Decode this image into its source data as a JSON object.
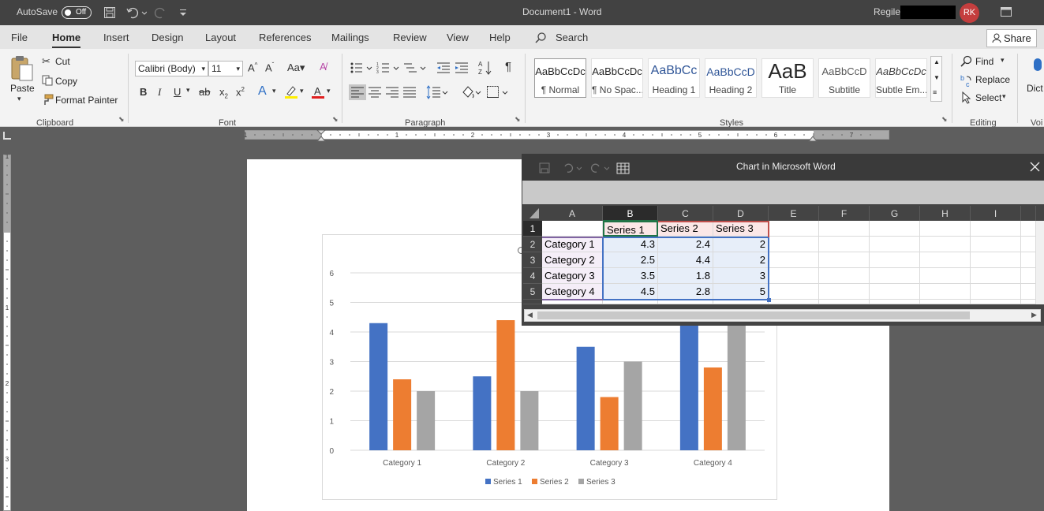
{
  "titlebar": {
    "autosave": "AutoSave",
    "toggle": "Off",
    "doc_title": "Document1  -  Word",
    "user": "Regile",
    "initials": "RK"
  },
  "menu": [
    "File",
    "Home",
    "Insert",
    "Design",
    "Layout",
    "References",
    "Mailings",
    "Review",
    "View",
    "Help"
  ],
  "search": "Search",
  "share": "Share",
  "clipboard": {
    "paste": "Paste",
    "cut": "Cut",
    "copy": "Copy",
    "format_painter": "Format Painter",
    "group": "Clipboard"
  },
  "font": {
    "name": "Calibri (Body)",
    "size": "11",
    "group": "Font"
  },
  "paragraph": {
    "group": "Paragraph"
  },
  "styles": {
    "group": "Styles",
    "items": [
      {
        "preview": "AaBbCcDc",
        "name": "¶ Normal"
      },
      {
        "preview": "AaBbCcDc",
        "name": "¶ No Spac..."
      },
      {
        "preview": "AaBbCc",
        "name": "Heading 1"
      },
      {
        "preview": "AaBbCcD",
        "name": "Heading 2"
      },
      {
        "preview": "AaB",
        "name": "Title"
      },
      {
        "preview": "AaBbCcD",
        "name": "Subtitle"
      },
      {
        "preview": "AaBbCcDc",
        "name": "Subtle Em..."
      }
    ]
  },
  "editing": {
    "find": "Find",
    "replace": "Replace",
    "select": "Select",
    "group": "Editing"
  },
  "clipped": {
    "dictate": "Dict",
    "voice": "Voi"
  },
  "ruler": {
    "h_marks": [
      "1",
      "1",
      "2",
      "3",
      "4",
      "5",
      "6",
      "7"
    ],
    "v_marks": [
      "1",
      "1",
      "2",
      "3"
    ]
  },
  "colors": {
    "series1": "#4472c4",
    "series2": "#ed7d31",
    "series3": "#a5a5a5",
    "accent_word": "#2b579a"
  },
  "chart_data": {
    "type": "bar",
    "categories": [
      "Category 1",
      "Category 2",
      "Category 3",
      "Category 4"
    ],
    "series": [
      {
        "name": "Series 1",
        "values": [
          4.3,
          2.5,
          3.5,
          4.5
        ]
      },
      {
        "name": "Series 2",
        "values": [
          2.4,
          4.4,
          1.8,
          2.8
        ]
      },
      {
        "name": "Series 3",
        "values": [
          2,
          2,
          3,
          5
        ]
      }
    ],
    "yticks": [
      "0",
      "1",
      "2",
      "3",
      "4",
      "5",
      "6"
    ],
    "ylim": [
      0,
      6
    ],
    "legend": "bottom",
    "grid": true
  },
  "excel": {
    "title": "Chart in Microsoft Word",
    "columns": [
      "A",
      "B",
      "C",
      "D",
      "E",
      "F",
      "G",
      "H",
      "I"
    ],
    "rows": [
      "1",
      "2",
      "3",
      "4",
      "5"
    ],
    "cells": [
      [
        "",
        "Series 1",
        "Series 2",
        "Series 3"
      ],
      [
        "Category 1",
        "4.3",
        "2.4",
        "2"
      ],
      [
        "Category 2",
        "2.5",
        "4.4",
        "2"
      ],
      [
        "Category 3",
        "3.5",
        "1.8",
        "3"
      ],
      [
        "Category 4",
        "4.5",
        "2.8",
        "5"
      ]
    ]
  }
}
